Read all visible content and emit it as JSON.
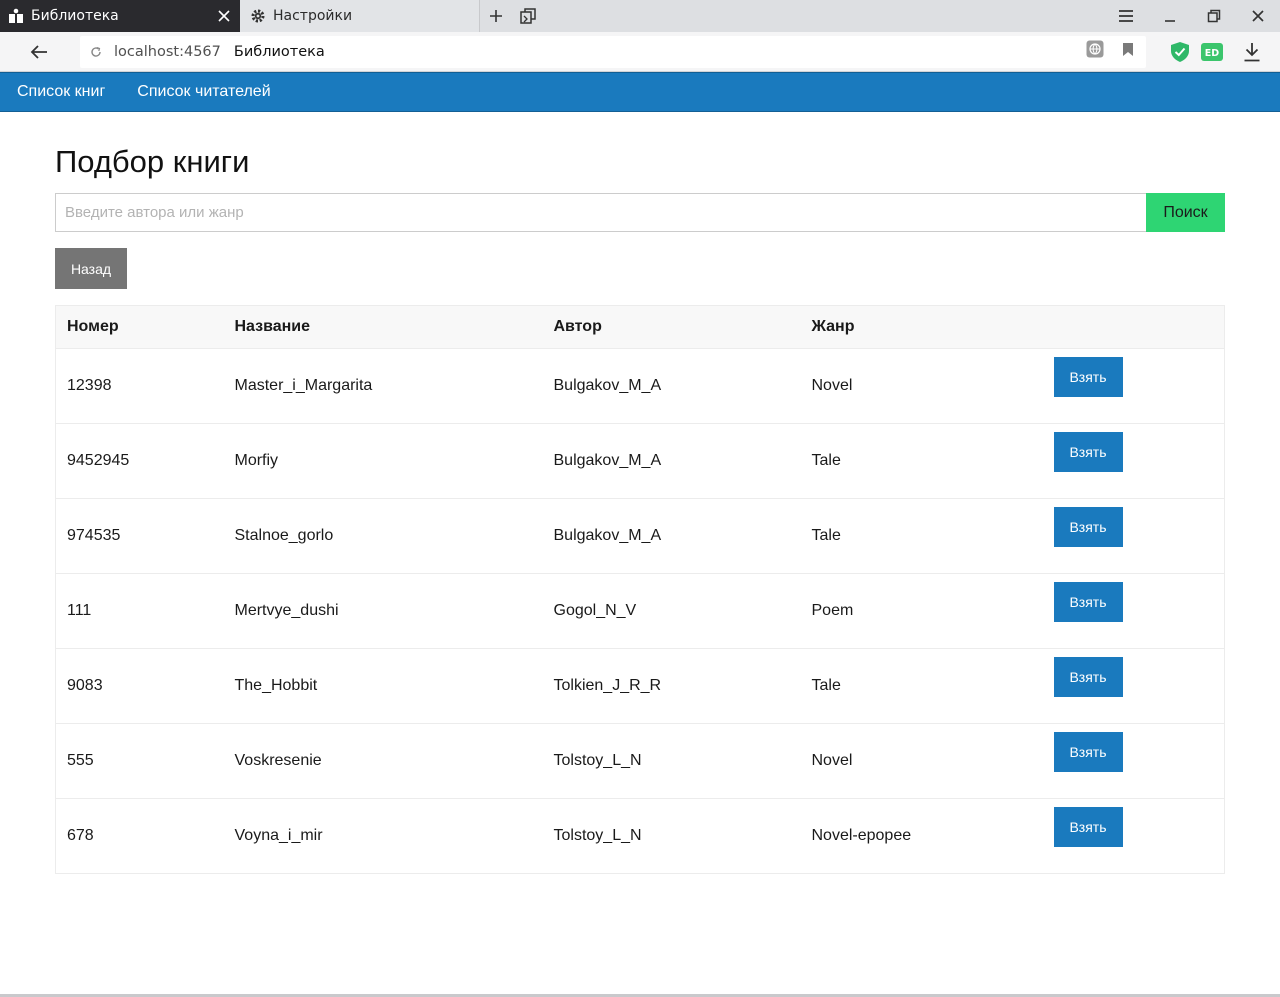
{
  "browser": {
    "tabs": [
      {
        "label": "Библиотека",
        "icon": "library-icon",
        "active": true
      },
      {
        "label": "Настройки",
        "icon": "gear-icon",
        "active": false
      }
    ],
    "url_host": "localhost:4567",
    "url_page_title": "Библиотека",
    "extension_ed_label": "ED"
  },
  "nav": {
    "books_list": "Список книг",
    "readers_list": "Список читателей"
  },
  "page": {
    "title": "Подбор книги",
    "search_placeholder": "Введите автора или жанр",
    "search_value": "",
    "search_button": "Поиск",
    "back_button": "Назад"
  },
  "table": {
    "headers": {
      "number": "Номер",
      "title": "Название",
      "author": "Автор",
      "genre": "Жанр",
      "action": ""
    },
    "take_label": "Взять",
    "rows": [
      {
        "number": "12398",
        "title": "Master_i_Margarita",
        "author": "Bulgakov_M_A",
        "genre": "Novel"
      },
      {
        "number": "9452945",
        "title": "Morfiy",
        "author": "Bulgakov_M_A",
        "genre": "Tale"
      },
      {
        "number": "974535",
        "title": "Stalnoe_gorlo",
        "author": "Bulgakov_M_A",
        "genre": "Tale"
      },
      {
        "number": "111",
        "title": "Mertvye_dushi",
        "author": "Gogol_N_V",
        "genre": "Poem"
      },
      {
        "number": "9083",
        "title": "The_Hobbit",
        "author": "Tolkien_J_R_R",
        "genre": "Tale"
      },
      {
        "number": "555",
        "title": "Voskresenie",
        "author": "Tolstoy_L_N",
        "genre": "Novel"
      },
      {
        "number": "678",
        "title": "Voyna_i_mir",
        "author": "Tolstoy_L_N",
        "genre": "Novel-epopee"
      }
    ]
  },
  "colors": {
    "navbar": "#1a7abe",
    "search_button": "#2ed573",
    "back_button": "#757575",
    "take_button": "#1a7abe"
  }
}
